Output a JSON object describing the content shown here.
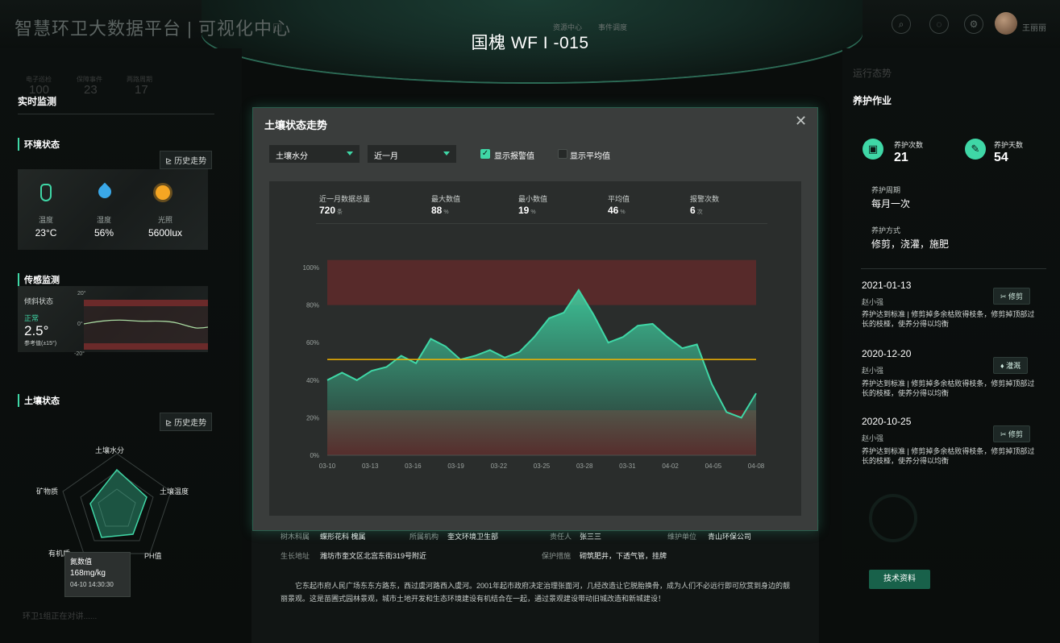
{
  "header": {
    "app_title": "智慧环卫大数据平台 | 可视化中心",
    "tree_title": "国槐 WF I -015",
    "tabs": [
      "资源中心",
      "事件调度"
    ],
    "user_name": "王丽丽"
  },
  "left": {
    "mini_stats": [
      {
        "label": "电子巡检",
        "value": "100"
      },
      {
        "label": "保障事件",
        "value": "23"
      },
      {
        "label": "两路周期",
        "value": "17"
      }
    ],
    "section_title": "实时监测",
    "env": {
      "title": "环境状态",
      "history_btn": "历史走势",
      "items": [
        {
          "label": "温度",
          "value": "23°C",
          "icon": "thermometer-icon"
        },
        {
          "label": "湿度",
          "value": "56%",
          "icon": "water-drop-icon"
        },
        {
          "label": "光照",
          "value": "5600lux",
          "icon": "sun-icon"
        }
      ]
    },
    "sensor": {
      "title": "传感监测",
      "tilt_label": "倾斜状态",
      "tilt_status": "正常",
      "tilt_value": "2.5°",
      "ref_label": "参考值(±15°)",
      "y_top": "20°",
      "y_mid": "0°",
      "y_bottom": "-20°"
    },
    "soil": {
      "title": "土壤状态",
      "history_btn": "历史走势",
      "radar_axes": [
        "土壤水分",
        "土壤温度",
        "PH值",
        "有机质",
        "矿物质"
      ],
      "tooltip_title": "氮数值",
      "tooltip_value": "168mg/kg",
      "tooltip_time": "04-10  14:30:30"
    },
    "footer_text": "环卫1组正在对讲......"
  },
  "modal": {
    "title": "土壤状态走势",
    "select_metric": "土壤水分",
    "select_range": "近一月",
    "show_alarm_label": "显示报警值",
    "show_alarm_checked": true,
    "show_avg_label": "显示平均值",
    "show_avg_checked": false,
    "stats": [
      {
        "label": "近一月数据总量",
        "value": "720",
        "unit": "条"
      },
      {
        "label": "最大数值",
        "value": "88",
        "unit": "%"
      },
      {
        "label": "最小数值",
        "value": "19",
        "unit": "%"
      },
      {
        "label": "平均值",
        "value": "46",
        "unit": "%"
      },
      {
        "label": "报警次数",
        "value": "6",
        "unit": "次"
      }
    ]
  },
  "chart_data": {
    "type": "area",
    "x": [
      "03-10",
      "03-11",
      "03-12",
      "03-13",
      "03-14",
      "03-15",
      "03-16",
      "03-17",
      "03-18",
      "03-19",
      "03-20",
      "03-21",
      "03-22",
      "03-23",
      "03-24",
      "03-25",
      "03-26",
      "03-27",
      "03-28",
      "03-29",
      "03-30",
      "03-31",
      "04-01",
      "04-02",
      "04-03",
      "04-04",
      "04-05",
      "04-06",
      "04-07",
      "04-08"
    ],
    "x_ticks": [
      "03-10",
      "03-13",
      "03-16",
      "03-19",
      "03-22",
      "03-25",
      "03-28",
      "03-31",
      "04-02",
      "04-05",
      "04-08"
    ],
    "y_ticks": [
      "0%",
      "20%",
      "40%",
      "60%",
      "80%",
      "100%"
    ],
    "values": [
      40,
      44,
      40,
      45,
      47,
      53,
      49,
      62,
      58,
      51,
      53,
      56,
      52,
      55,
      63,
      73,
      76,
      88,
      75,
      60,
      63,
      69,
      70,
      63,
      57,
      59,
      38,
      23,
      20,
      33
    ],
    "reference_line": 51,
    "alarm_bands": [
      [
        0,
        24
      ],
      [
        80,
        104
      ]
    ],
    "ylim": [
      0,
      100
    ],
    "colors": {
      "line": "#3fd7a6",
      "reference": "#f4b400",
      "band": "#6b2a2a"
    }
  },
  "right": {
    "faded_title": "运行态势",
    "section_title": "养护作业",
    "care_count_label": "养护次数",
    "care_count_value": "21",
    "care_days_label": "养护天数",
    "care_days_value": "54",
    "cycle_label": "养护周期",
    "cycle_value": "每月一次",
    "method_label": "养护方式",
    "method_value": "修剪，浇灌，施肥",
    "records": [
      {
        "date": "2021-01-13",
        "person": "赵小强",
        "tag": "修剪",
        "desc": "养护达到标准 | 修剪掉多余枯败得枝条，修剪掉顶部过长的枝桠，使养分得以均衡"
      },
      {
        "date": "2020-12-20",
        "person": "赵小强",
        "tag": "灌溉",
        "desc": "养护达到标准 | 修剪掉多余枯败得枝条，修剪掉顶部过长的枝桠，使养分得以均衡"
      },
      {
        "date": "2020-10-25",
        "person": "赵小强",
        "tag": "修剪",
        "desc": "养护达到标准 | 修剪掉多余枯败得枝条，修剪掉顶部过长的枝桠，使养分得以均衡"
      }
    ],
    "tech_button": "技术资料"
  },
  "info": {
    "rows": [
      [
        {
          "k": "树木科属",
          "v": "蝶形花科 槐属"
        },
        {
          "k": "所属机构",
          "v": "奎文环境卫生部"
        },
        {
          "k": "责任人",
          "v": "张三三"
        },
        {
          "k": "维护单位",
          "v": "青山环保公司"
        }
      ],
      [
        {
          "k": "生长地址",
          "v": "潍坊市奎文区北宫东街319号附近"
        },
        {
          "k": "保护措施",
          "v": "砌筑肥井，下透气管，挂牌"
        }
      ]
    ],
    "description": "它东起市府人民广场东东方路东，西过虞河路西入虞河。2001年起市政府决定治理张面河，几经改造让它脱胎换骨，成为人们不必远行即可欣赏到身边的靓丽景观。这是苗圃式园林景观，城市土地开发和生态环境建设有机结合在一起，通过景观建设带动旧城改造和新城建设！"
  }
}
